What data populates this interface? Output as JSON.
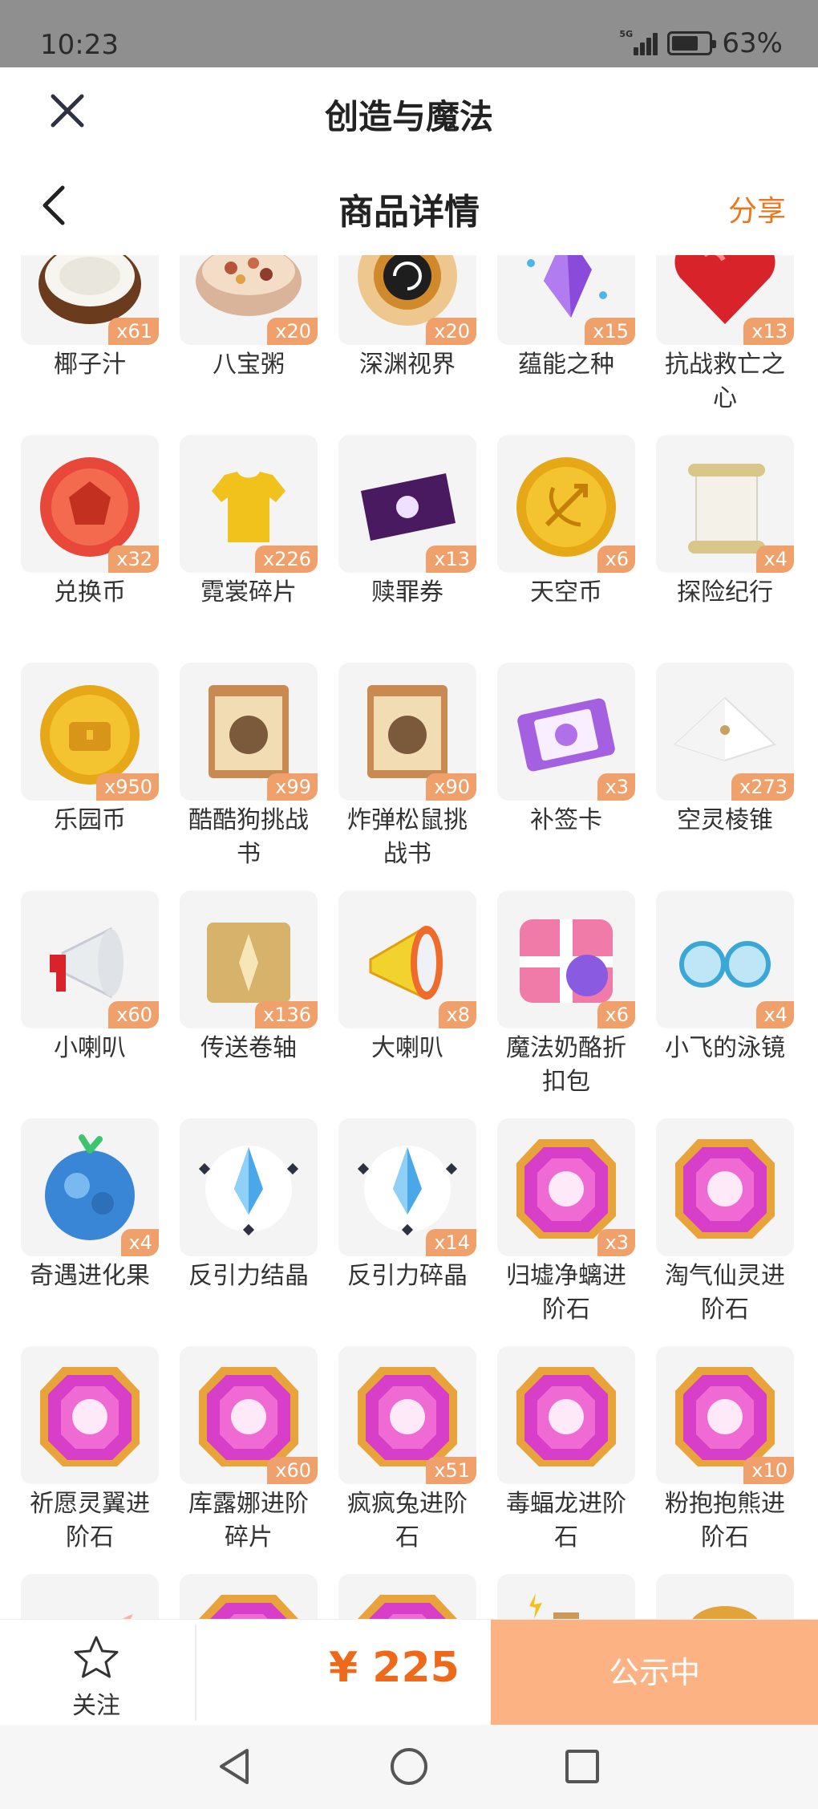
{
  "status_bar": {
    "time": "10:23",
    "network": "5G",
    "battery_percent": "63%",
    "battery_level": 0.63
  },
  "app_bar": {
    "title": "创造与魔法"
  },
  "page_header": {
    "title": "商品详情",
    "share_label": "分享"
  },
  "colors": {
    "accent": "#ee6a1a",
    "status_button": "#fcb283",
    "count_badge": "#f0a06a"
  },
  "items": [
    {
      "name": "椰子汁",
      "count": "x61",
      "icon": "coconut-icon"
    },
    {
      "name": "八宝粥",
      "count": "x20",
      "icon": "porridge-bowl-icon"
    },
    {
      "name": "深渊视界",
      "count": "x20",
      "icon": "abyss-sun-icon"
    },
    {
      "name": "蕴能之种",
      "count": "x15",
      "icon": "purple-crystal-icon"
    },
    {
      "name": "抗战救亡之心",
      "count": "x13",
      "icon": "red-heart-gem-icon"
    },
    {
      "name": "兑换币",
      "count": "x32",
      "icon": "red-coin-icon"
    },
    {
      "name": "霓裳碎片",
      "count": "x226",
      "icon": "yellow-shirt-icon"
    },
    {
      "name": "赎罪券",
      "count": "x13",
      "icon": "purple-ticket-icon"
    },
    {
      "name": "天空币",
      "count": "x6",
      "icon": "bow-coin-icon"
    },
    {
      "name": "探险纪行",
      "count": "x4",
      "icon": "scroll-icon"
    },
    {
      "name": "乐园币",
      "count": "x950",
      "icon": "chest-coin-icon"
    },
    {
      "name": "酷酷狗挑战书",
      "count": "x99",
      "icon": "wanted-poster-icon"
    },
    {
      "name": "炸弹松鼠挑战书",
      "count": "x90",
      "icon": "wanted-poster-icon"
    },
    {
      "name": "补签卡",
      "count": "x3",
      "icon": "purple-card-icon"
    },
    {
      "name": "空灵棱锥",
      "count": "x273",
      "icon": "white-pyramid-icon"
    },
    {
      "name": "小喇叭",
      "count": "x60",
      "icon": "small-megaphone-icon"
    },
    {
      "name": "传送卷轴",
      "count": "x136",
      "icon": "teleport-scroll-icon"
    },
    {
      "name": "大喇叭",
      "count": "x8",
      "icon": "big-megaphone-icon"
    },
    {
      "name": "魔法奶酪折扣包",
      "count": "x6",
      "icon": "gift-box-icon"
    },
    {
      "name": "小飞的泳镜",
      "count": "x4",
      "icon": "goggles-icon"
    },
    {
      "name": "奇遇进化果",
      "count": "x4",
      "icon": "blue-fruit-icon"
    },
    {
      "name": "反引力结晶",
      "count": "",
      "icon": "crystal-emblem-icon"
    },
    {
      "name": "反引力碎晶",
      "count": "x14",
      "icon": "crystal-emblem-icon"
    },
    {
      "name": "归墟净螭进阶石",
      "count": "x3",
      "icon": "gem-stone-icon"
    },
    {
      "name": "淘气仙灵进阶石",
      "count": "",
      "icon": "gem-stone-icon"
    },
    {
      "name": "祈愿灵翼进阶石",
      "count": "",
      "icon": "gem-stone-icon"
    },
    {
      "name": "库露娜进阶碎片",
      "count": "x60",
      "icon": "gem-stone-icon"
    },
    {
      "name": "疯疯兔进阶石",
      "count": "x51",
      "icon": "gem-stone-icon"
    },
    {
      "name": "毒蝠龙进阶石",
      "count": "",
      "icon": "gem-stone-icon"
    },
    {
      "name": "粉抱抱熊进阶石",
      "count": "x10",
      "icon": "gem-stone-icon"
    },
    {
      "name": "",
      "count": "",
      "icon": "feather-icon"
    },
    {
      "name": "",
      "count": "",
      "icon": "gem-stone-icon"
    },
    {
      "name": "",
      "count": "",
      "icon": "gem-stone-icon"
    },
    {
      "name": "",
      "count": "",
      "icon": "potion-bottle-icon"
    },
    {
      "name": "",
      "count": "",
      "icon": "golden-mask-icon"
    }
  ],
  "bottom_bar": {
    "favorite_label": "关注",
    "price": "¥ 225",
    "status_button_label": "公示中"
  }
}
